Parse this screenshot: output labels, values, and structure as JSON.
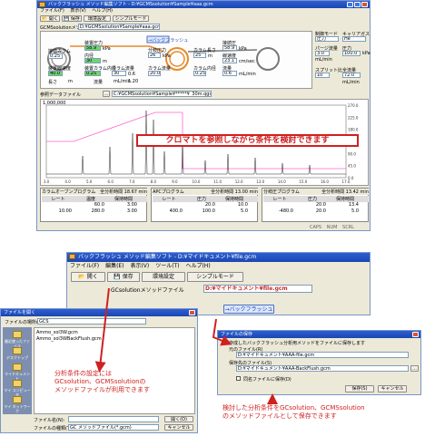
{
  "top": {
    "title": "バックフラッシュ メソッド編集ソフト - D:¥GCMSsolution¥Sample¥aaa.gcm",
    "menu": [
      "ファイル(F)",
      "表示(V)",
      "ヘルプ(H)"
    ],
    "toolbar": {
      "open": "開く",
      "save": "保存",
      "env": "環境設定",
      "simple": "シンプルモード"
    },
    "method_file_label": "GCMSsolutionメソッドファイル",
    "method_file_path": "D:¥GCMSsolution¥Sample¥aaa.gcm",
    "backflush_button": "→バックフラッシュ",
    "left_cols": {
      "a1": "装置圧力",
      "a1u": "kPa",
      "a1v": "58.9",
      "a2": "接続カラム",
      "a2v": "0.25",
      "a3": "内径",
      "a3v": "30",
      "a3u": "m",
      "b1": "装置線速度",
      "b1v": "40.0",
      "b2": "装置カラム内径",
      "b2v": "0.25",
      "b3": "カラム流量",
      "b3v": "30",
      "c1": "長さ",
      "c1u": "m",
      "c2": "流量",
      "c2u": "mL/min",
      "c3": "0.6",
      "c3b": "1.20"
    },
    "mid_cols": {
      "p1": "分岐圧力",
      "p1v": "26",
      "p1u": "kPa",
      "p2": "カラム長さ",
      "p2v": "25",
      "p2u": "m",
      "p3": "カラム内径",
      "p3v": "0.25",
      "p4": "カラム流量",
      "p4v": "20.0"
    },
    "right_cols": {
      "r1": "接続圧",
      "r1v": "58.9",
      "r2": "線速度",
      "r2v": "23.1",
      "r3": "流量",
      "r3v": "0.6",
      "r4": "kPa",
      "r5": "cm/sec",
      "r6": "mL/min"
    },
    "mode_panel": {
      "mode_label": "制御モード",
      "carrier_label": "キャリアガス",
      "mode_value": "圧力",
      "carrier_value": "He",
      "purge_label": "パージ流量",
      "purge_value": "3.0",
      "pressure_label": "圧力",
      "pressure_value": "100.0",
      "split_label": "スプリット比",
      "split_value": "10",
      "total_label": "全流量",
      "total_value": "72.0",
      "u1": "mL/min",
      "u2": "kPa",
      "u3": "mL/min"
    },
    "chroma_label": "参照データファイル",
    "chroma_path": "C:¥GCMSsolution¥Sample¥*****¥_30m.qgd",
    "y_max": "1,000,000",
    "x_ticks": [
      "3.0",
      "4.0",
      "5.0",
      "6.0",
      "7.0",
      "8.0",
      "9.0",
      "10.0",
      "11.0",
      "12.0",
      "13.0",
      "14.0",
      "15.0",
      "16.0",
      "17.0"
    ],
    "right_scale": [
      "270.0",
      "225.0",
      "180.0",
      "135.0",
      "90.0",
      "45.0",
      "0.0"
    ],
    "banner": "クロマトを参照しながら条件を検討できます",
    "prog_left": {
      "title": "カラムオーブンプログラム",
      "time": "全分析時間 18.67 min",
      "cols": [
        "レート",
        "温度",
        "保持時間"
      ],
      "rows": [
        [
          "",
          "60.0",
          "3.00"
        ],
        [
          "10.00",
          "280.0",
          "3.00"
        ]
      ]
    },
    "prog_mid": {
      "title": "APCプログラム",
      "time": "全分析時間 13.00 min",
      "cols": [
        "レート",
        "圧力",
        "保持時間"
      ],
      "rows": [
        [
          "",
          "20.0",
          "10.0"
        ],
        [
          "400.0",
          "100.0",
          "5.0"
        ]
      ]
    },
    "prog_right": {
      "title": "分岐圧プログラム",
      "time": "全分析時間 13.42 min",
      "cols": [
        "レート",
        "圧力",
        "保持時間"
      ],
      "rows": [
        [
          "",
          "20.0",
          "13.4"
        ],
        [
          "-480.0",
          "20.0",
          "5.0"
        ]
      ]
    },
    "status": [
      "CAPS",
      "NUM",
      "SCRL"
    ]
  },
  "bottom": {
    "title": "バックフラッシュ メソッド編集ソフト - D:¥マイドキュメント¥file.gcm",
    "menu": [
      "ファイル(F)",
      "編集(E)",
      "表示(V)",
      "ツール(T)",
      "ヘルプ(H)"
    ],
    "toolbar": {
      "open": "開く",
      "save": "保存",
      "env": "環境設定",
      "simple": "シンプルモード"
    },
    "method_label": "GCsolutionメソッドファイル",
    "method_path": "D:¥マイドキュメント¥file.gcm",
    "backflush_button": "→バックフラッシュ"
  },
  "open_dialog": {
    "title": "ファイルを開く",
    "lookin_label": "ファイルの場所(I):",
    "lookin_value": "GCS",
    "files": [
      "Ammo_sol3W.gcm",
      "Ammo_sol3WBackFlush.gcm"
    ],
    "places": [
      "最近使ったファイル",
      "デスクトップ",
      "マイドキュメント",
      "マイ コンピュータ",
      "マイ ネットワーク"
    ],
    "filename_label": "ファイル名(N):",
    "filetype_label": "ファイルの種類(T):",
    "filetype_value": "GC メソッドファイル(*.gcm)",
    "open_btn": "開く(O)",
    "cancel_btn": "キャンセル",
    "note": "分析条件の設定には\nGCsolution、GCMSsolutionの\nメソッドファイルが利用できます"
  },
  "save_dialog": {
    "title": "ファイルの保存",
    "desc": "作成したバックフラッシュ分析用メソッドをファイルに保存します",
    "orig_label": "元のファイル(R)",
    "orig_value": "D:¥マイドキュメント¥AAA-file.gcm",
    "save_label": "保存先のファイル(S)",
    "save_value": "D:¥マイドキュメント¥AAA-BackFlush.gcm",
    "check_label": "同名ファイルに保存(D)",
    "ok_btn": "保存(S)",
    "cancel_btn": "キャンセル",
    "note": "検討した分析条件をGCsolution、GCMSsolution\nのメソッドファイルとして保存できます"
  },
  "colors": {
    "accent": "#d02020",
    "titlebar": "#1b46b0",
    "green": "#6cd66c",
    "pink": "#ff66cc",
    "orange": "#e88a2a"
  }
}
